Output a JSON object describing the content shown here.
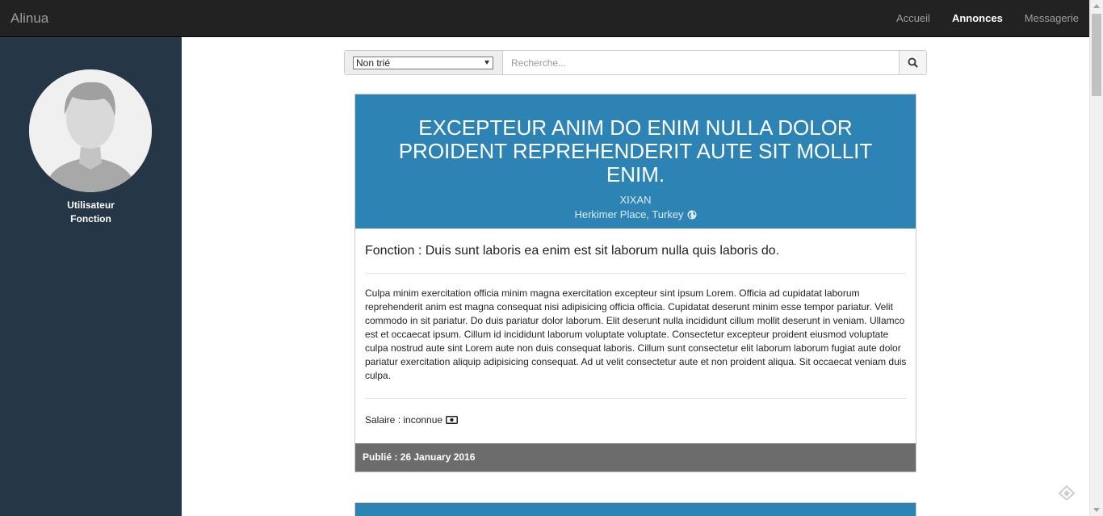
{
  "navbar": {
    "brand": "Alinua",
    "links": [
      {
        "label": "Accueil",
        "active": false
      },
      {
        "label": "Annonces",
        "active": true
      },
      {
        "label": "Messagerie",
        "active": false
      }
    ]
  },
  "sidebar": {
    "user_name": "Utilisateur",
    "user_role": "Fonction",
    "avatar_icon": "user-silhouette-icon"
  },
  "search": {
    "sort_value": "Non trié",
    "placeholder": "Recherche...",
    "button_icon": "search-icon"
  },
  "listing": {
    "title": "EXCEPTEUR ANIM DO ENIM NULLA DOLOR PROIDENT REPREHENDERIT AUTE SIT MOLLIT ENIM.",
    "company": "XIXAN",
    "location": "Herkimer Place, Turkey",
    "location_icon": "globe-icon",
    "fonction": "Fonction : Duis sunt laboris ea enim est sit laborum nulla quis laboris do.",
    "description": "Culpa minim exercitation officia minim magna exercitation excepteur sint ipsum Lorem. Officia ad cupidatat laborum reprehenderit anim est magna consequat nisi adipisicing officia officia. Cupidatat deserunt minim esse tempor pariatur. Velit commodo in sit pariatur. Do duis pariatur dolor laborum. Elit deserunt nulla incididunt cillum mollit deserunt in veniam. Ullamco est et occaecat ipsum. Cillum id incididunt laborum voluptate voluptate. Consectetur excepteur proident eiusmod voluptate culpa nostrud aute sint Lorem aute non duis consequat laboris. Cillum sunt consectetur elit laborum laborum fugiat aute dolor pariatur exercitation aliquip adipisicing consequat. Ad ut velit consectetur aute et non proident aliqua. Sit occaecat veniam duis culpa.",
    "salary": "Salaire : inconnue",
    "salary_icon": "money-icon",
    "published": "Publié : 26 January 2016",
    "header_color": "#2c83b4",
    "footer_color": "#6c6c6c"
  },
  "colors": {
    "navbar": "#222222",
    "sidebar": "#253746"
  }
}
